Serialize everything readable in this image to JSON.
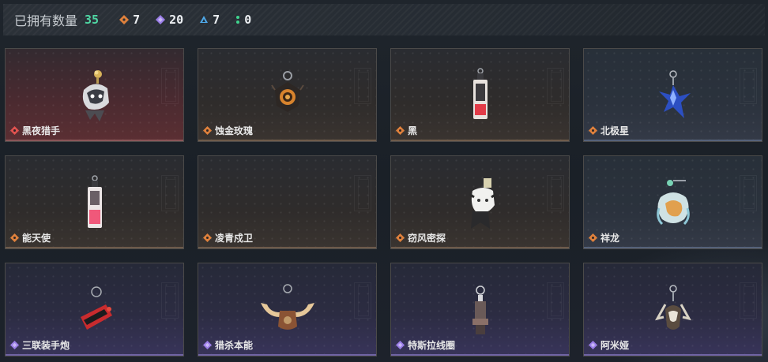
{
  "header": {
    "owned_label": "已拥有数量",
    "owned_count": "35",
    "stats": [
      {
        "icon": "orange-diamond-icon",
        "color": "#e0813c",
        "value": "7"
      },
      {
        "icon": "purple-diamond-icon",
        "color": "#9b7ee8",
        "value": "20"
      },
      {
        "icon": "blue-triangle-icon",
        "color": "#4fa8e8",
        "value": "7"
      },
      {
        "icon": "green-dots-icon",
        "color": "#3fd48e",
        "value": "0"
      }
    ]
  },
  "charms": [
    {
      "name": "黑夜猎手",
      "rarity_color": "#e2524f"
    },
    {
      "name": "蚀金玫瑰",
      "rarity_color": "#e0813c"
    },
    {
      "name": "黑",
      "rarity_color": "#e0813c"
    },
    {
      "name": "北极星",
      "rarity_color": "#e0813c"
    },
    {
      "name": "能天使",
      "rarity_color": "#e0813c"
    },
    {
      "name": "凌青戍卫",
      "rarity_color": "#e0813c"
    },
    {
      "name": "窃风密探",
      "rarity_color": "#e0813c"
    },
    {
      "name": "祥龙",
      "rarity_color": "#e0813c"
    },
    {
      "name": "三联装手炮",
      "rarity_color": "#9b7ee8"
    },
    {
      "name": "猎杀本能",
      "rarity_color": "#9b7ee8"
    },
    {
      "name": "特斯拉线圈",
      "rarity_color": "#9b7ee8"
    },
    {
      "name": "阿米娅",
      "rarity_color": "#9b7ee8"
    }
  ]
}
